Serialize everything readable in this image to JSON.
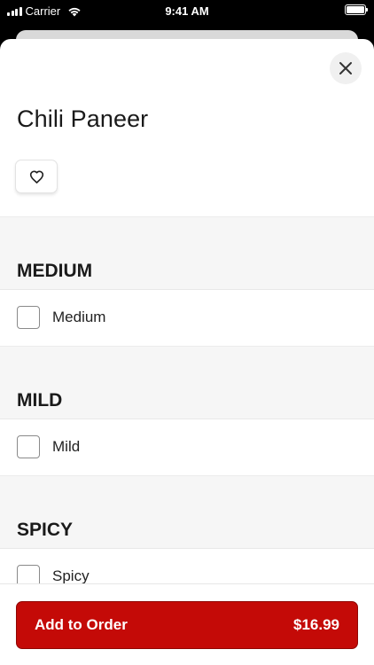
{
  "status_bar": {
    "carrier": "Carrier",
    "time": "9:41 AM"
  },
  "item": {
    "title": "Chili Paneer"
  },
  "icons": {
    "close": "close-icon",
    "favorite": "heart-outline-icon",
    "signal": "signal-icon",
    "wifi": "wifi-icon",
    "battery": "battery-icon"
  },
  "option_groups": [
    {
      "header": "MEDIUM",
      "options": [
        {
          "label": "Medium",
          "checked": false
        }
      ]
    },
    {
      "header": "MILD",
      "options": [
        {
          "label": "Mild",
          "checked": false
        }
      ]
    },
    {
      "header": "SPICY",
      "options": [
        {
          "label": "Spicy",
          "checked": false
        }
      ]
    }
  ],
  "add_button": {
    "label": "Add to Order",
    "price": "$16.99"
  },
  "colors": {
    "accent": "#c40a07",
    "section_bg": "#f6f6f6"
  }
}
